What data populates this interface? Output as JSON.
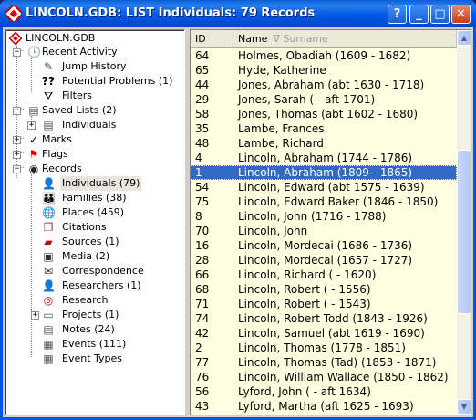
{
  "window": {
    "title": "LINCOLN.GDB: LIST Individuals:  79 Records",
    "help_glyph": "?",
    "minimize_glyph": "_",
    "maximize_glyph": "□",
    "close_glyph": "✕"
  },
  "tree": {
    "root": "LINCOLN.GDB",
    "recent_activity": "Recent Activity",
    "jump_history": "Jump History",
    "potential_problems": "Potential Problems (1)",
    "filters": "Filters",
    "saved_lists": "Saved Lists (2)",
    "saved_individuals": "Individuals",
    "marks": "Marks",
    "flags": "Flags",
    "records": "Records",
    "individuals": "Individuals (79)",
    "families": "Families (38)",
    "places": "Places (459)",
    "citations": "Citations",
    "sources": "Sources (1)",
    "media": "Media (2)",
    "correspondence": "Correspondence",
    "researchers": "Researchers (1)",
    "research": "Research",
    "projects": "Projects (1)",
    "notes": "Notes (24)",
    "events": "Events (111)",
    "event_types": "Event Types",
    "expander_plus": "+",
    "expander_minus": "−"
  },
  "list": {
    "columns": {
      "id": "ID",
      "name": "Name",
      "sort_icon": "∇",
      "subname": "Surname"
    },
    "selected_index": 8,
    "rows": [
      {
        "id": "64",
        "name": "Holmes, Obadiah (1609 - 1682)"
      },
      {
        "id": "65",
        "name": "Hyde, Katherine"
      },
      {
        "id": "44",
        "name": "Jones, Abraham (abt 1630 - 1718)"
      },
      {
        "id": "29",
        "name": "Jones, Sarah ( - aft 1701)"
      },
      {
        "id": "58",
        "name": "Jones, Thomas (abt 1602 - 1680)"
      },
      {
        "id": "35",
        "name": "Lambe, Frances"
      },
      {
        "id": "48",
        "name": "Lambe, Richard"
      },
      {
        "id": "4",
        "name": "Lincoln, Abraham (1744 - 1786)"
      },
      {
        "id": "1",
        "name": "Lincoln, Abraham (1809 - 1865)"
      },
      {
        "id": "54",
        "name": "Lincoln, Edward (abt 1575 - 1639)"
      },
      {
        "id": "75",
        "name": "Lincoln, Edward Baker (1846 - 1850)"
      },
      {
        "id": "8",
        "name": "Lincoln, John (1716 - 1788)"
      },
      {
        "id": "70",
        "name": "Lincoln, John"
      },
      {
        "id": "16",
        "name": "Lincoln, Mordecai (1686 - 1736)"
      },
      {
        "id": "28",
        "name": "Lincoln, Mordecai (1657 - 1727)"
      },
      {
        "id": "66",
        "name": "Lincoln, Richard ( - 1620)"
      },
      {
        "id": "68",
        "name": "Lincoln, Robert ( - 1556)"
      },
      {
        "id": "71",
        "name": "Lincoln, Robert ( - 1543)"
      },
      {
        "id": "74",
        "name": "Lincoln, Robert Todd (1843 - 1926)"
      },
      {
        "id": "42",
        "name": "Lincoln, Samuel (abt 1619 - 1690)"
      },
      {
        "id": "2",
        "name": "Lincoln, Thomas (1778 - 1851)"
      },
      {
        "id": "77",
        "name": "Lincoln, Thomas (Tad) (1853 - 1871)"
      },
      {
        "id": "76",
        "name": "Lincoln, William Wallace (1850 - 1862)"
      },
      {
        "id": "56",
        "name": "Lyford, John ( - aft 1634)"
      },
      {
        "id": "43",
        "name": "Lyford, Martha (aft 1625 - 1693)"
      }
    ],
    "scroll_up_glyph": "▲",
    "scroll_down_glyph": "▼",
    "scroll_position": 0.55
  },
  "colors": {
    "list_background": "#ffffe1",
    "selection": "#316ac5",
    "titlebar": "#0058e6"
  }
}
